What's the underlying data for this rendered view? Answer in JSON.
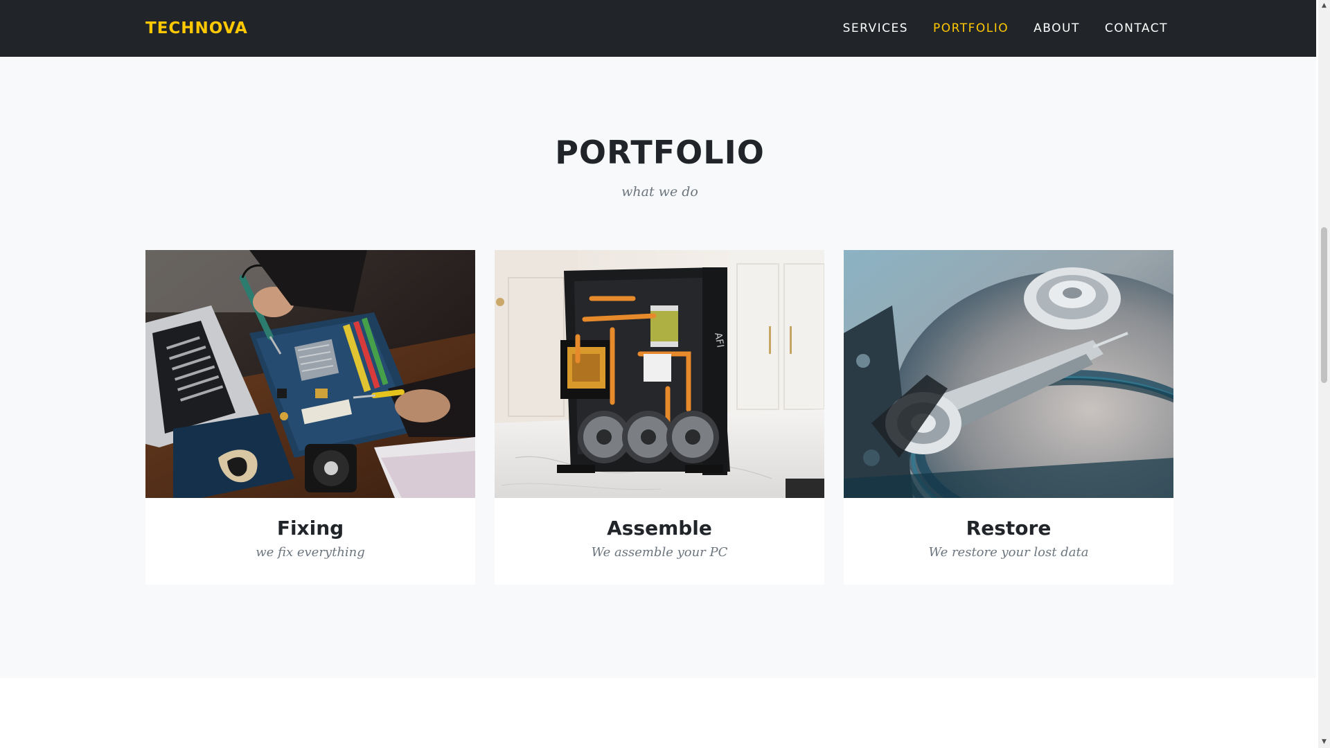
{
  "navbar": {
    "brand": "TECHNOVA",
    "links": [
      {
        "label": "SERVICES",
        "active": false
      },
      {
        "label": "PORTFOLIO",
        "active": true
      },
      {
        "label": "ABOUT",
        "active": false
      },
      {
        "label": "CONTACT",
        "active": false
      }
    ]
  },
  "portfolio": {
    "title": "PORTFOLIO",
    "subtitle": "what we do",
    "items": [
      {
        "heading": "Fixing",
        "subheading": "we fix everything",
        "image_icon": "motherboard-soldering-photo"
      },
      {
        "heading": "Assemble",
        "subheading": "We assemble your PC",
        "image_icon": "pc-build-photo"
      },
      {
        "heading": "Restore",
        "subheading": "We restore your lost data",
        "image_icon": "hard-drive-photo"
      }
    ]
  },
  "colors": {
    "accent": "#ffc800",
    "navbar_bg": "#212529",
    "section_bg": "#f8f9fa",
    "heading": "#212529",
    "muted": "#6c757d"
  }
}
